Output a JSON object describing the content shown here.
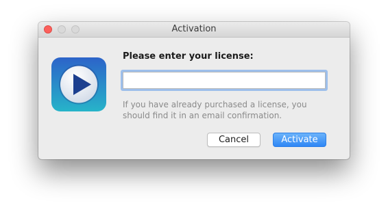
{
  "window": {
    "title": "Activation"
  },
  "dialog": {
    "prompt": "Please enter your license:",
    "license_value": "",
    "helper_text": "If you have already purchased a license, you should find it in an email confirmation.",
    "cancel_label": "Cancel",
    "activate_label": "Activate",
    "app_icon": "play-icon"
  },
  "colors": {
    "accent": "#3a8ef6",
    "icon_background_top": "#2f6fd0",
    "icon_background_bottom": "#25b0c8",
    "close_button": "#fc605c"
  }
}
